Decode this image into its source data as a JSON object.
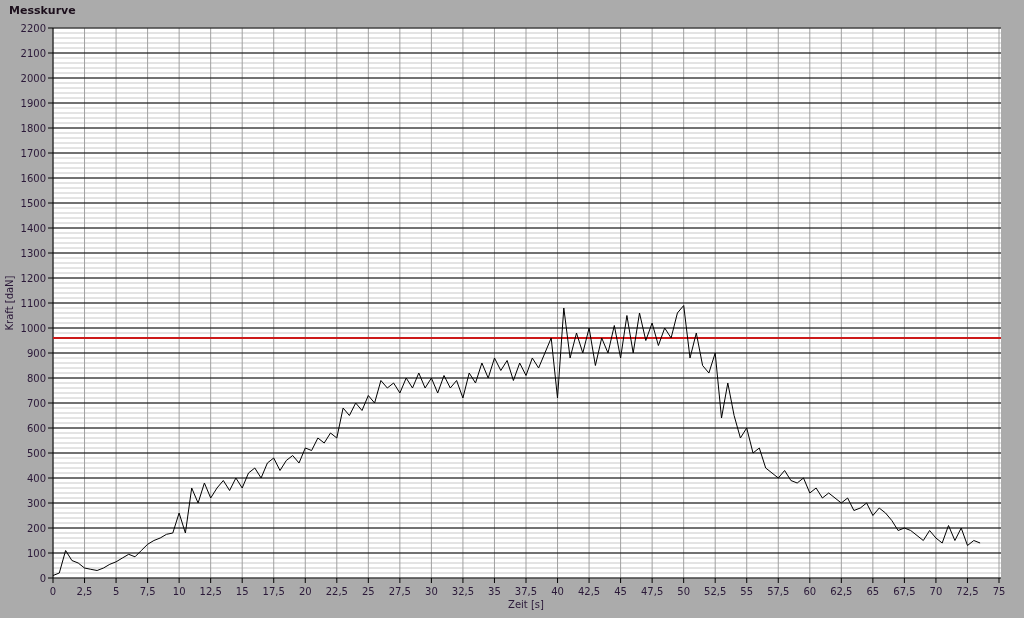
{
  "title": "Messkurve",
  "chart_data": {
    "type": "line",
    "xlabel": "Zeit [s]",
    "ylabel": "Kraft [daN]",
    "xlim": [
      0,
      75
    ],
    "ylim": [
      0,
      2200
    ],
    "xticks": [
      0,
      {
        "value": 2.5,
        "label": "2,5"
      },
      5,
      {
        "value": 7.5,
        "label": "7,5"
      },
      10,
      {
        "value": 12.5,
        "label": "12,5"
      },
      15,
      {
        "value": 17.5,
        "label": "17,5"
      },
      20,
      {
        "value": 22.5,
        "label": "22,5"
      },
      25,
      {
        "value": 27.5,
        "label": "27,5"
      },
      30,
      {
        "value": 32.5,
        "label": "32,5"
      },
      35,
      {
        "value": 37.5,
        "label": "37,5"
      },
      40,
      {
        "value": 42.5,
        "label": "42,5"
      },
      45,
      {
        "value": 47.5,
        "label": "47,5"
      },
      50,
      {
        "value": 52.5,
        "label": "52,5"
      },
      55,
      {
        "value": 57.5,
        "label": "57,5"
      },
      60,
      {
        "value": 62.5,
        "label": "62,5"
      },
      65,
      {
        "value": 67.5,
        "label": "67,5"
      },
      70,
      {
        "value": 72.5,
        "label": "72,5"
      },
      75
    ],
    "yticks": [
      0,
      100,
      200,
      300,
      400,
      500,
      600,
      700,
      800,
      900,
      1000,
      1100,
      1200,
      1300,
      1400,
      1500,
      1600,
      1700,
      1800,
      1900,
      2000,
      2100,
      2200
    ],
    "x": [
      0,
      0.5,
      1,
      1.5,
      2,
      2.5,
      3,
      3.5,
      4,
      4.5,
      5,
      5.5,
      6,
      6.5,
      7,
      7.5,
      8,
      8.5,
      9,
      9.5,
      10,
      10.5,
      11,
      11.5,
      12,
      12.5,
      13,
      13.5,
      14,
      14.5,
      15,
      15.5,
      16,
      16.5,
      17,
      17.5,
      18,
      18.5,
      19,
      19.5,
      20,
      20.5,
      21,
      21.5,
      22,
      22.5,
      23,
      23.5,
      24,
      24.5,
      25,
      25.5,
      26,
      26.5,
      27,
      27.5,
      28,
      28.5,
      29,
      29.5,
      30,
      30.5,
      31,
      31.5,
      32,
      32.5,
      33,
      33.5,
      34,
      34.5,
      35,
      35.5,
      36,
      36.5,
      37,
      37.5,
      38,
      38.5,
      39,
      39.5,
      40,
      40.5,
      41,
      41.5,
      42,
      42.5,
      43,
      43.5,
      44,
      44.5,
      45,
      45.5,
      46,
      46.5,
      47,
      47.5,
      48,
      48.5,
      49,
      49.5,
      50,
      50.5,
      51,
      51.5,
      52,
      52.5,
      53,
      53.5,
      54,
      54.5,
      55,
      55.5,
      56,
      56.5,
      57,
      57.5,
      58,
      58.5,
      59,
      59.5,
      60,
      60.5,
      61,
      61.5,
      62,
      62.5,
      63,
      63.5,
      64,
      64.5,
      65,
      65.5,
      66,
      66.5,
      67,
      67.5,
      68,
      68.5,
      69,
      69.5,
      70,
      70.5,
      71,
      71.5,
      72,
      72.5,
      73,
      73.5
    ],
    "series": [
      {
        "color": "#000000",
        "values": [
          10,
          20,
          110,
          70,
          60,
          40,
          35,
          30,
          40,
          55,
          65,
          80,
          95,
          85,
          110,
          135,
          150,
          160,
          175,
          180,
          260,
          180,
          360,
          300,
          380,
          320,
          360,
          390,
          350,
          400,
          360,
          420,
          440,
          400,
          460,
          480,
          430,
          470,
          490,
          460,
          520,
          510,
          560,
          540,
          580,
          560,
          680,
          650,
          700,
          670,
          730,
          700,
          790,
          760,
          780,
          740,
          800,
          760,
          820,
          760,
          800,
          740,
          810,
          760,
          790,
          720,
          820,
          780,
          860,
          800,
          880,
          830,
          870,
          790,
          860,
          810,
          880,
          840,
          900,
          960,
          720,
          1080,
          880,
          980,
          900,
          1000,
          850,
          960,
          900,
          1010,
          880,
          1050,
          900,
          1060,
          950,
          1020,
          930,
          1000,
          960,
          1060,
          1090,
          880,
          980,
          850,
          820,
          900,
          640,
          780,
          650,
          560,
          600,
          500,
          520,
          440,
          420,
          400,
          430,
          390,
          380,
          400,
          340,
          360,
          320,
          340,
          320,
          300,
          320,
          270,
          280,
          300,
          250,
          280,
          260,
          230,
          190,
          200,
          190,
          170,
          150,
          190,
          160,
          140,
          210,
          150,
          200,
          130,
          150,
          140
        ]
      }
    ],
    "grid": true,
    "ref_lines": [
      {
        "axis": "y",
        "value": 960,
        "color": "#cc1a1a"
      }
    ]
  }
}
